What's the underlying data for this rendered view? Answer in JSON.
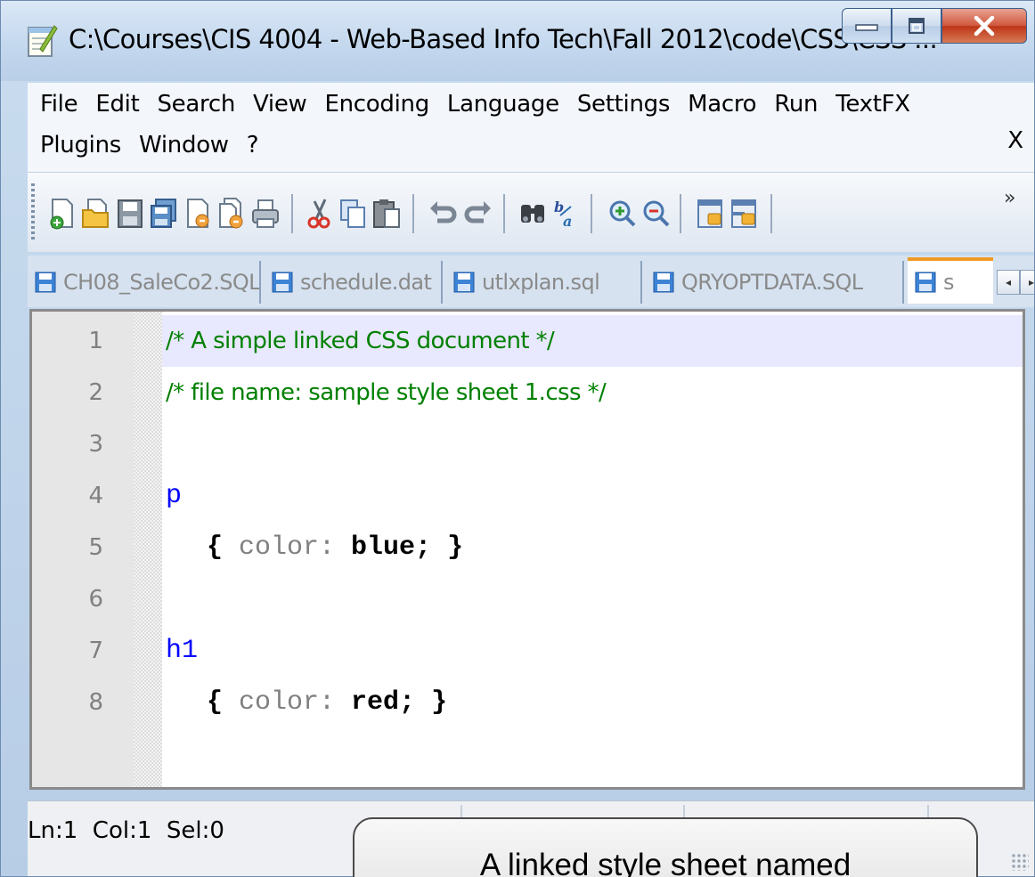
{
  "window": {
    "title": "C:\\Courses\\CIS 4004 - Web-Based Info Tech\\Fall 2012\\code\\CSS\\CSS ..."
  },
  "menu": {
    "row1": [
      "File",
      "Edit",
      "Search",
      "View",
      "Encoding",
      "Language",
      "Settings",
      "Macro",
      "Run",
      "TextFX"
    ],
    "row2": [
      "Plugins",
      "Window",
      "?"
    ],
    "close_label": "X"
  },
  "toolbar": {
    "buttons": [
      "new-file-icon",
      "open-folder-icon",
      "save-icon",
      "save-all-icon",
      "close-file-icon",
      "close-all-icon",
      "print-icon",
      "cut-icon",
      "copy-icon",
      "paste-icon",
      "undo-icon",
      "redo-icon",
      "find-icon",
      "replace-icon",
      "zoom-in-icon",
      "zoom-out-icon",
      "sync-vertical-icon",
      "sync-horizontal-icon"
    ],
    "more_label": "»"
  },
  "tabs": [
    {
      "label": "CH08_SaleCo2.SQL"
    },
    {
      "label": "schedule.dat"
    },
    {
      "label": "utlxplan.sql"
    },
    {
      "label": "QRYOPTDATA.SQL"
    },
    {
      "label": "s",
      "active": true
    }
  ],
  "tab_nav": {
    "prev": "◂",
    "next": "▸"
  },
  "editor": {
    "lines": [
      {
        "num": "1",
        "current": true
      },
      {
        "num": "2"
      },
      {
        "num": "3"
      },
      {
        "num": "4"
      },
      {
        "num": "5"
      },
      {
        "num": "6"
      },
      {
        "num": "7"
      },
      {
        "num": "8"
      }
    ],
    "code": {
      "l1": "/* A simple linked CSS document */",
      "l2": "/* file name: sample style sheet 1.css */",
      "l4_selector": "p",
      "l5_open": "{ ",
      "l5_prop": "color:",
      "l5_value": " blue; }",
      "l7_selector": "h1",
      "l8_open": "{ ",
      "l8_prop": "color:",
      "l8_value": " red; }"
    }
  },
  "status": {
    "position": "Ln:1  Col:1  Sel:0"
  },
  "callout": {
    "text": "A linked style sheet named"
  },
  "colors": {
    "comment": "#008000",
    "selector": "#0000ff",
    "property": "#808080",
    "current_line": "#e8e8ff",
    "active_tab_accent": "#f09a24"
  }
}
